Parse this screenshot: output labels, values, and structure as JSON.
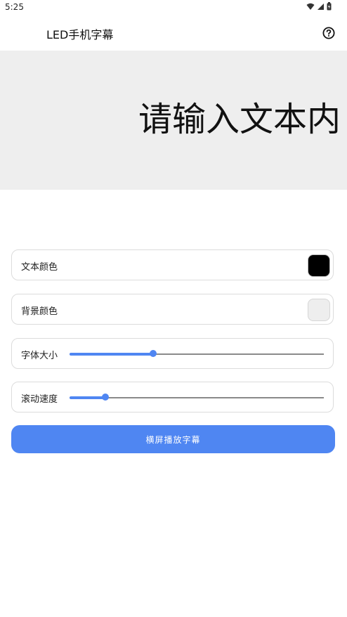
{
  "status_bar": {
    "time": "5:25"
  },
  "app_bar": {
    "title": "LED手机字幕"
  },
  "preview": {
    "text": "请输入文本内"
  },
  "settings": {
    "text_color": {
      "label": "文本颜色",
      "value": "#000000"
    },
    "bg_color": {
      "label": "背景颜色",
      "value": "#eeeeee"
    },
    "font_size": {
      "label": "字体大小",
      "level": 0.33
    },
    "scroll_speed": {
      "label": "滚动速度",
      "level": 0.14
    }
  },
  "actions": {
    "play_label": "横屏播放字幕"
  },
  "colors": {
    "accent": "#4f86f2",
    "preview_bg": "#eeeeee",
    "card_border": "#dcdcdc"
  }
}
